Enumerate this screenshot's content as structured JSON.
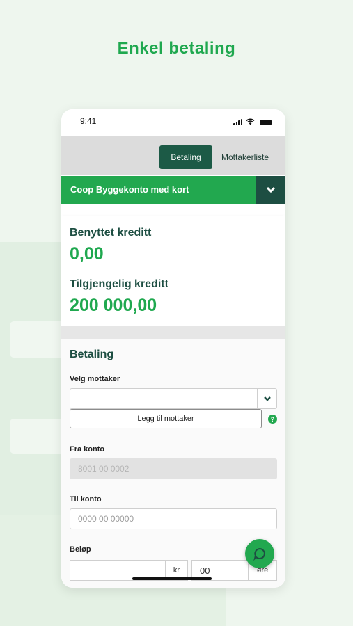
{
  "headline": "Enkel betaling",
  "status": {
    "time": "9:41"
  },
  "tabs": {
    "active": "Betaling",
    "other": "Mottakerliste"
  },
  "account": {
    "name": "Coop Byggekonto med kort"
  },
  "credit": {
    "used_label": "Benyttet kreditt",
    "used_value": "0,00",
    "available_label": "Tilgjengelig kreditt",
    "available_value": "200 000,00"
  },
  "payment": {
    "title": "Betaling",
    "recipient_label": "Velg mottaker",
    "recipient_value": "",
    "add_recipient": "Legg til mottaker",
    "help_icon": "?",
    "from_label": "Fra konto",
    "from_value": "8001 00 0002",
    "to_label": "Til konto",
    "to_placeholder": "0000 00 00000",
    "amount_label": "Beløp",
    "kr_label": "kr",
    "ore_value": "00",
    "ore_label": "øre"
  },
  "colors": {
    "brand_green": "#22a84f",
    "dark_green": "#1d4e42"
  },
  "icons": {
    "chevron": "chevron-down-icon",
    "chat": "chat-icon",
    "help": "help-icon"
  }
}
